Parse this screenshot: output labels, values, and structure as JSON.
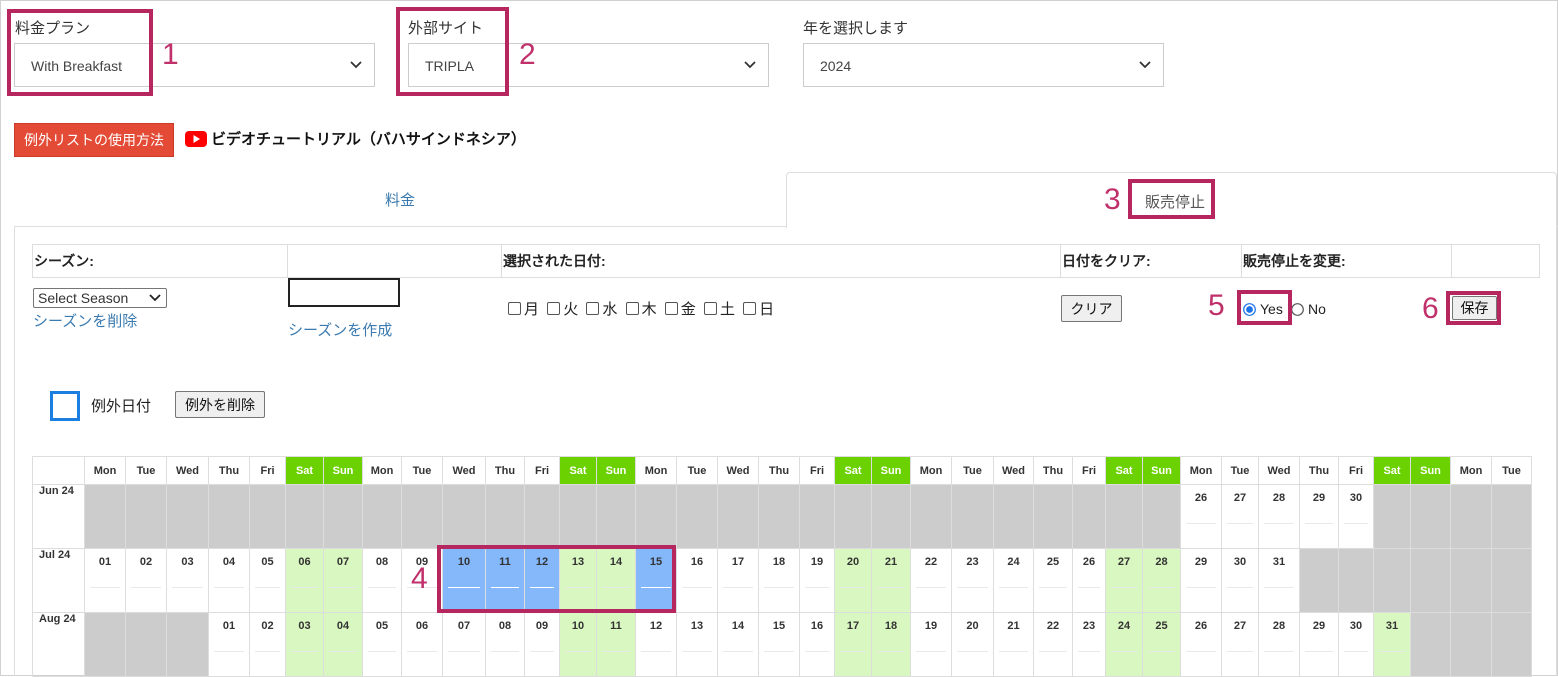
{
  "filters": {
    "plan": {
      "label": "料金プラン",
      "value": "With Breakfast"
    },
    "site": {
      "label": "外部サイト",
      "value": "TRIPLA"
    },
    "year": {
      "label": "年を選択します",
      "value": "2024"
    }
  },
  "actions": {
    "howto_button": "例外リストの使用方法",
    "video_link": "ビデオチュートリアル（バハサインドネシア）"
  },
  "tabs": {
    "rates": "料金",
    "stop_sale": "販売停止"
  },
  "panel": {
    "season_header": "シーズン:",
    "selected_dates_header": "選択された日付:",
    "clear_header": "日付をクリア:",
    "stop_change_header": "販売停止を変更:",
    "season_select": "Select Season",
    "delete_season": "シーズンを削除",
    "create_season": "シーズンを作成",
    "weekdays": [
      "月",
      "火",
      "水",
      "木",
      "金",
      "土",
      "日"
    ],
    "clear_button": "クリア",
    "yes_label": "Yes",
    "no_label": "No",
    "save_button": "保存",
    "legend_label": "例外日付",
    "delete_exceptions_button": "例外を削除"
  },
  "annotations": [
    "1",
    "2",
    "3",
    "4",
    "5",
    "6"
  ],
  "calendar": {
    "days": [
      "Mon",
      "Tue",
      "Wed",
      "Thu",
      "Fri",
      "Sat",
      "Sun",
      "Mon",
      "Tue",
      "Wed",
      "Thu",
      "Fri",
      "Sat",
      "Sun",
      "Mon",
      "Tue",
      "Wed",
      "Thu",
      "Fri",
      "Sat",
      "Sun",
      "Mon",
      "Tue",
      "Wed",
      "Thu",
      "Fri",
      "Sat",
      "Sun",
      "Mon",
      "Tue",
      "Wed",
      "Thu",
      "Fri",
      "Sat",
      "Sun",
      "Mon",
      "Tue"
    ],
    "rows": [
      {
        "label": "Jun 24",
        "start": 29,
        "days": [
          "26",
          "27",
          "28",
          "29",
          "30"
        ]
      },
      {
        "label": "Jul 24",
        "start": 1,
        "days": [
          "01",
          "02",
          "03",
          "04",
          "05",
          "06",
          "07",
          "08",
          "09",
          "10",
          "11",
          "12",
          "13",
          "14",
          "15",
          "16",
          "17",
          "18",
          "19",
          "20",
          "21",
          "22",
          "23",
          "24",
          "25",
          "26",
          "27",
          "28",
          "29",
          "30",
          "31"
        ]
      },
      {
        "label": "Aug 24",
        "start": 4,
        "days": [
          "01",
          "02",
          "03",
          "04",
          "05",
          "06",
          "07",
          "08",
          "09",
          "10",
          "11",
          "12",
          "13",
          "14",
          "15",
          "16",
          "17",
          "18",
          "19",
          "20",
          "21",
          "22",
          "23",
          "24",
          "25",
          "26",
          "27",
          "28",
          "29",
          "30",
          "31"
        ]
      }
    ],
    "selected": {
      "row": 1,
      "days": [
        "10",
        "11",
        "12",
        "13",
        "14",
        "15"
      ]
    }
  },
  "colors": {
    "highlight": "#b7275f",
    "weekend": "#6bd100",
    "weekend_cell": "#d9f7c0",
    "selected_cell": "#84b8fb",
    "button_red": "#e34b36"
  }
}
